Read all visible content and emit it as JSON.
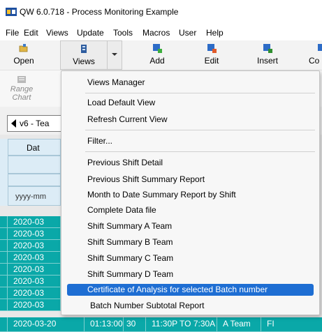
{
  "window": {
    "title": "QW 6.0.718 - Process Monitoring Example",
    "icon": "qw-app-icon"
  },
  "menubar": {
    "items": [
      "File",
      "Edit",
      "Views",
      "Update",
      "Tools",
      "Macros",
      "User",
      "Help"
    ]
  },
  "toolbar": {
    "buttons": [
      {
        "label": "Open",
        "icon": "folder-open-icon"
      },
      {
        "label": "Views",
        "icon": "views-icon"
      },
      {
        "label": "Add",
        "icon": "grid-add-icon"
      },
      {
        "label": "Edit",
        "icon": "grid-edit-icon"
      },
      {
        "label": "Insert",
        "icon": "grid-insert-icon"
      },
      {
        "label": "Co",
        "icon": "grid-copy-icon"
      }
    ]
  },
  "toolbar2": {
    "range_chart": "Range Chart"
  },
  "view_selector": {
    "value": "v6 - Tea"
  },
  "grid": {
    "header_label": "Dat",
    "format_label": "yyyy-mm",
    "rows": [
      "2020-03",
      "2020-03",
      "2020-03",
      "2020-03",
      "2020-03",
      "2020-03",
      "2020-03",
      "2020-03"
    ],
    "last_row": [
      "2020-03-20",
      "01:13:00",
      "30",
      "11:30P TO 7:30A",
      "A Team",
      "FI"
    ]
  },
  "dropdown": {
    "items": [
      "Views Manager",
      "Load Default View",
      "Refresh Current View",
      "Filter...",
      "Previous Shift Detail",
      "Previous Shift Summary Report",
      "Month to Date Summary Report by Shift",
      "Complete Data file",
      "Shift Summary A Team",
      "Shift Summary B Team",
      "Shift Summary C Team",
      "Shift Summary D Team",
      "Certificate of Analysis for selected Batch number",
      "Batch Number Subtotal Report"
    ],
    "selected_index": 12
  },
  "colors": {
    "grid_teal": "#0aa8a8",
    "highlight": "#1e6ed3",
    "header_blue": "#dcecf6"
  }
}
